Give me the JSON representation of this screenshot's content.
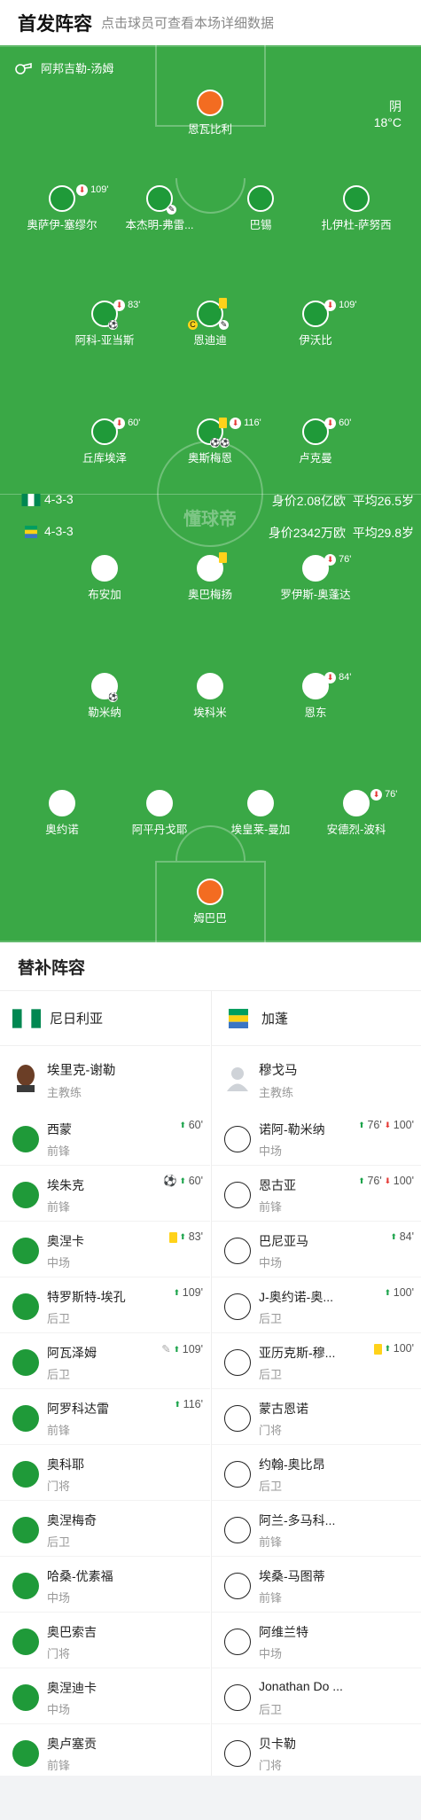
{
  "header": {
    "title": "首发阵容",
    "subtitle": "点击球员可查看本场详细数据"
  },
  "pitch": {
    "referee": "阿邦吉勒-汤姆",
    "weather": "阴",
    "temperature": "18°C",
    "watermark": "懂球帝",
    "home": {
      "formation": "4-3-3",
      "value": "身价2.08亿欧",
      "avg_age": "平均26.5岁",
      "color": "#1f9a39"
    },
    "away": {
      "formation": "4-3-3",
      "value": "身价2342万欧",
      "avg_age": "平均29.8岁",
      "color": "#ffffff"
    },
    "home_players": [
      {
        "name": "恩瓦比利",
        "gk": true
      },
      {
        "name": "奥萨伊-塞缪尔",
        "sub": "109'"
      },
      {
        "name": "本杰明-弗雷..."
      },
      {
        "name": "巴锡"
      },
      {
        "name": "扎伊杜-萨努西"
      },
      {
        "name": "阿科-亚当斯",
        "sub": "83'"
      },
      {
        "name": "恩迪迪"
      },
      {
        "name": "伊沃比",
        "sub": "109'"
      },
      {
        "name": "丘库埃泽",
        "sub": "60'"
      },
      {
        "name": "奥斯梅恩",
        "sub": "116'"
      },
      {
        "name": "卢克曼",
        "sub": "60'"
      }
    ],
    "away_players": [
      {
        "name": "布安加"
      },
      {
        "name": "奥巴梅扬"
      },
      {
        "name": "罗伊斯-奥蓬达",
        "sub": "76'"
      },
      {
        "name": "勒米纳"
      },
      {
        "name": "埃科米"
      },
      {
        "name": "恩东",
        "sub": "84'"
      },
      {
        "name": "奥约诺"
      },
      {
        "name": "阿平丹戈耶"
      },
      {
        "name": "埃皇莱-曼加"
      },
      {
        "name": "安德烈-波科",
        "sub": "76'"
      },
      {
        "name": "姆巴巴",
        "gk": true
      }
    ]
  },
  "subs": {
    "title": "替补阵容",
    "home": {
      "team": "尼日利亚",
      "coach": {
        "name": "埃里克-谢勒",
        "role": "主教练"
      },
      "players": [
        {
          "name": "西蒙",
          "pos": "前锋",
          "ev": "60'"
        },
        {
          "name": "埃朱克",
          "pos": "前锋",
          "ev": "60'"
        },
        {
          "name": "奥涅卡",
          "pos": "中场",
          "ev": "83'"
        },
        {
          "name": "特罗斯特-埃孔",
          "pos": "后卫",
          "ev": "109'"
        },
        {
          "name": "阿瓦泽姆",
          "pos": "后卫",
          "ev": "109'"
        },
        {
          "name": "阿罗科达雷",
          "pos": "前锋",
          "ev": "116'"
        },
        {
          "name": "奥科耶",
          "pos": "门将",
          "ev": ""
        },
        {
          "name": "奥涅梅奇",
          "pos": "后卫",
          "ev": ""
        },
        {
          "name": "哈桑-优素福",
          "pos": "中场",
          "ev": ""
        },
        {
          "name": "奥巴索吉",
          "pos": "门将",
          "ev": ""
        },
        {
          "name": "奥涅迪卡",
          "pos": "中场",
          "ev": ""
        },
        {
          "name": "奥卢塞贡",
          "pos": "前锋",
          "ev": ""
        }
      ]
    },
    "away": {
      "team": "加蓬",
      "coach": {
        "name": "穆戈马",
        "role": "主教练"
      },
      "players": [
        {
          "name": "诺阿-勒米纳",
          "pos": "中场",
          "ev1": "76'",
          "ev2": "100'"
        },
        {
          "name": "恩古亚",
          "pos": "前锋",
          "ev1": "76'",
          "ev2": "100'"
        },
        {
          "name": "巴尼亚马",
          "pos": "中场",
          "ev1": "84'",
          "ev2": ""
        },
        {
          "name": "J-奥约诺-奥...",
          "pos": "后卫",
          "ev1": "100'",
          "ev2": ""
        },
        {
          "name": "亚历克斯-穆...",
          "pos": "后卫",
          "ev1": "100'",
          "ev2": ""
        },
        {
          "name": "蒙古恩诺",
          "pos": "门将",
          "ev1": "",
          "ev2": ""
        },
        {
          "name": "约翰-奥比昂",
          "pos": "后卫",
          "ev1": "",
          "ev2": ""
        },
        {
          "name": "阿兰-多马科...",
          "pos": "前锋",
          "ev1": "",
          "ev2": ""
        },
        {
          "name": "埃桑-马图蒂",
          "pos": "前锋",
          "ev1": "",
          "ev2": ""
        },
        {
          "name": "阿维兰特",
          "pos": "中场",
          "ev1": "",
          "ev2": ""
        },
        {
          "name": "Jonathan Do ...",
          "pos": "后卫",
          "ev1": "",
          "ev2": ""
        },
        {
          "name": "贝卡勒",
          "pos": "门将",
          "ev1": "",
          "ev2": ""
        }
      ]
    }
  }
}
